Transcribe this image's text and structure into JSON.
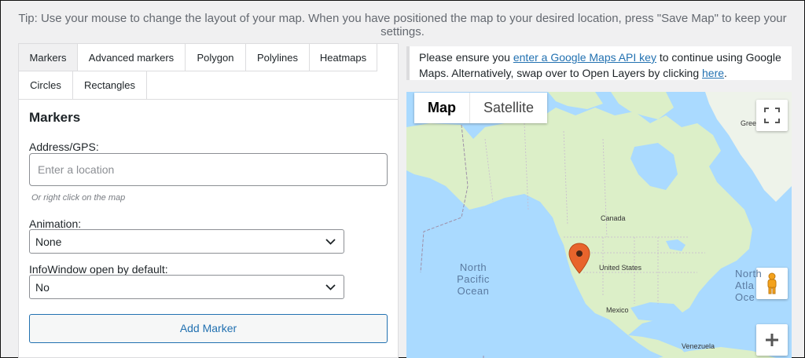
{
  "tip": "Tip: Use your mouse to change the layout of your map. When you have positioned the map to your desired location, press \"Save Map\" to keep your settings.",
  "tabs": [
    {
      "label": "Markers",
      "active": true
    },
    {
      "label": "Advanced markers"
    },
    {
      "label": "Polygon"
    },
    {
      "label": "Polylines"
    },
    {
      "label": "Heatmaps"
    },
    {
      "label": "Circles"
    },
    {
      "label": "Rectangles"
    }
  ],
  "markers_panel": {
    "title": "Markers",
    "address_label": "Address/GPS:",
    "address_placeholder": "Enter a location",
    "address_value": "",
    "address_hint": "Or right click on the map",
    "animation_label": "Animation:",
    "animation_value": "None",
    "infowindow_label": "InfoWindow open by default:",
    "infowindow_value": "No",
    "add_button": "Add Marker"
  },
  "notice": {
    "text_before": "Please ensure you ",
    "link1": "enter a Google Maps API key",
    "text_middle": " to continue using Google Maps. Alternatively, swap over to Open Layers by clicking ",
    "link2": "here",
    "text_after": "."
  },
  "map": {
    "type_map": "Map",
    "type_satellite": "Satellite",
    "labels": {
      "greenland": "Gree",
      "canada": "Canada",
      "united_states": "United States",
      "mexico": "Mexico",
      "venezuela": "Venezuela",
      "north_pacific_1": "North",
      "north_pacific_2": "Pacific",
      "north_pacific_3": "Ocean",
      "north_atlantic_1": "North",
      "north_atlantic_2": "Atla",
      "north_atlantic_3": "Oce"
    },
    "icons": [
      "fullscreen-icon",
      "pegman-icon",
      "zoom-in-icon",
      "marker-pin-icon",
      "chevron-down-icon"
    ],
    "colors": {
      "water": "#aadaff",
      "land": "#dcefc8",
      "marker": "#e8642c",
      "link": "#2271b1"
    }
  }
}
